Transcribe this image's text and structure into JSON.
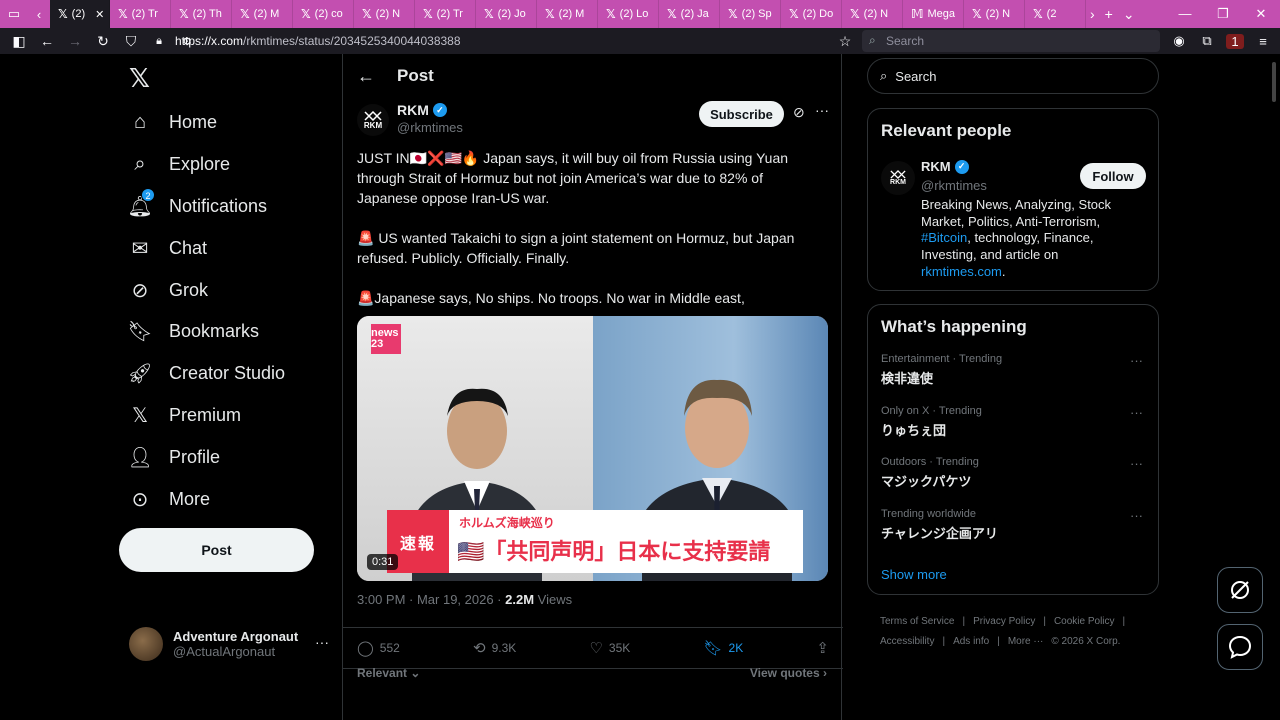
{
  "browser": {
    "tabs": [
      {
        "label": "(2)",
        "active": true
      },
      {
        "label": "(2) Tr"
      },
      {
        "label": "(2) Th"
      },
      {
        "label": "(2) M"
      },
      {
        "label": "(2) co"
      },
      {
        "label": "(2) N"
      },
      {
        "label": "(2) Tr"
      },
      {
        "label": "(2) Jo"
      },
      {
        "label": "(2) M"
      },
      {
        "label": "(2) Lo"
      },
      {
        "label": "(2) Ja"
      },
      {
        "label": "(2) Sp"
      },
      {
        "label": "(2) Do"
      },
      {
        "label": "(2) N"
      },
      {
        "label": "Mega"
      },
      {
        "label": "(2) N"
      },
      {
        "label": "(2"
      }
    ],
    "url_domain": "https://x.com",
    "url_path": "/rkmtimes/status/2034525340044038388",
    "search_placeholder": "Search",
    "ublock_count": "1"
  },
  "sidebar": {
    "items": [
      {
        "label": "Home",
        "icon": "home-icon"
      },
      {
        "label": "Explore",
        "icon": "search-icon"
      },
      {
        "label": "Notifications",
        "icon": "bell-icon",
        "badge": "2"
      },
      {
        "label": "Chat",
        "icon": "mail-icon"
      },
      {
        "label": "Grok",
        "icon": "grok-icon"
      },
      {
        "label": "Bookmarks",
        "icon": "bookmark-icon"
      },
      {
        "label": "Creator Studio",
        "icon": "rocket-icon"
      },
      {
        "label": "Premium",
        "icon": "x-icon"
      },
      {
        "label": "Profile",
        "icon": "person-icon"
      },
      {
        "label": "More",
        "icon": "more-circle-icon"
      }
    ],
    "post_button": "Post",
    "account": {
      "name": "Adventure Argonaut",
      "handle": "@ActualArgonaut"
    }
  },
  "main": {
    "header_title": "Post",
    "tweet": {
      "author": "RKM",
      "handle": "@rkmtimes",
      "subscribe": "Subscribe",
      "para1": "JUST IN🇯🇵❌🇺🇸🔥 Japan says, it will buy oil from Russia using Yuan through Strait of Hormuz but not join America’s war due to 82% of Japanese oppose Iran-US war.",
      "para2": "🚨 US wanted Takaichi to sign a joint statement on Hormuz, but Japan refused. Publicly. Officially. Finally.",
      "para3": "🚨Japanese says, No ships. No troops. No war in Middle east,",
      "media": {
        "news_badge": "news 23",
        "caption_red": "速報",
        "caption_small": "ホルムズ海峡巡り",
        "caption_large": "🇺🇸「共同声明」日本に支持要請",
        "duration": "0:31"
      },
      "timestamp": "3:00 PM · Mar 19, 2026 · ",
      "views_count": "2.2M",
      "views_label": " Views",
      "replies": "552",
      "reposts": "9.3K",
      "likes": "35K",
      "bookmarks": "2K",
      "relevant": "Relevant",
      "view_quotes": "View quotes"
    }
  },
  "right": {
    "search_placeholder": "Search",
    "relevant_people": {
      "title": "Relevant people",
      "name": "RKM",
      "handle": "@rkmtimes",
      "follow": "Follow",
      "bio_1": "Breaking News, Analyzing, Stock Market, Politics, Anti-Terrorism, ",
      "bio_hashtag": "#Bitcoin",
      "bio_2": ", technology, Finance, Investing, and article on ",
      "bio_link": "rkmtimes.com",
      "bio_end": "."
    },
    "whats_happening": {
      "title": "What’s happening",
      "trends": [
        {
          "category": "Entertainment · Trending",
          "name": "検非違使"
        },
        {
          "category": "Only on X · Trending",
          "name": "りゅちぇ団"
        },
        {
          "category": "Outdoors · Trending",
          "name": "マジックパケツ"
        },
        {
          "category": "Trending worldwide",
          "name": "チャレンジ企画アリ"
        }
      ],
      "show_more": "Show more"
    },
    "footer": {
      "links": [
        "Terms of Service",
        "Privacy Policy",
        "Cookie Policy",
        "Accessibility",
        "Ads info",
        "More ···"
      ],
      "copyright": "© 2026 X Corp."
    }
  }
}
